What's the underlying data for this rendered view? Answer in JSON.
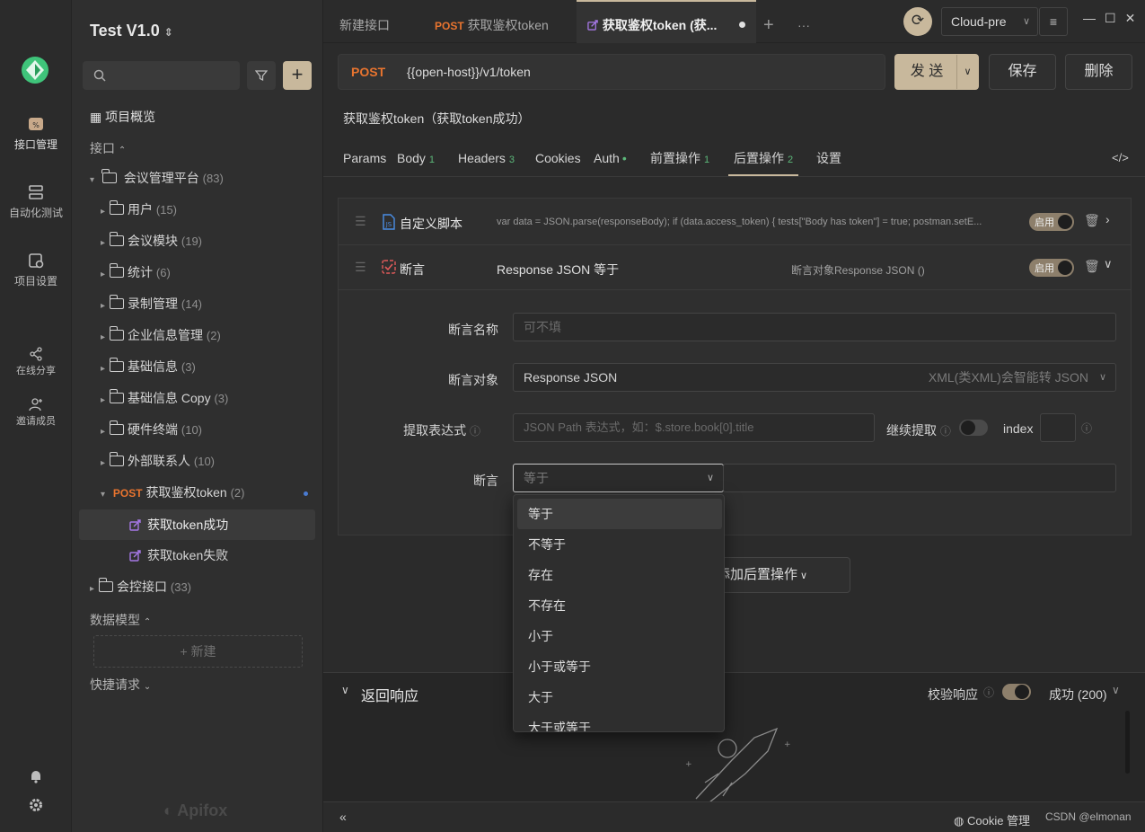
{
  "rail": {
    "items": [
      {
        "label": "接口管理",
        "icon": "api-manage-icon"
      },
      {
        "label": "自动化测试",
        "icon": "automation-icon"
      },
      {
        "label": "项目设置",
        "icon": "project-settings-icon"
      },
      {
        "label": "在线分享",
        "icon": "share-icon"
      },
      {
        "label": "邀请成员",
        "icon": "invite-member-icon"
      }
    ]
  },
  "sidebar": {
    "project_title": "Test V1.0",
    "overview": "项目概览",
    "section_api": "接口",
    "root_folder": {
      "name": "会议管理平台",
      "count": "(83)"
    },
    "folders": [
      {
        "name": "用户",
        "count": "(15)"
      },
      {
        "name": "会议模块",
        "count": "(19)"
      },
      {
        "name": "统计",
        "count": "(6)"
      },
      {
        "name": "录制管理",
        "count": "(14)"
      },
      {
        "name": "企业信息管理",
        "count": "(2)"
      },
      {
        "name": "基础信息",
        "count": "(3)"
      },
      {
        "name": "基础信息 Copy",
        "count": "(3)"
      },
      {
        "name": "硬件终端",
        "count": "(10)"
      },
      {
        "name": "外部联系人",
        "count": "(10)"
      }
    ],
    "endpoint": {
      "method": "POST",
      "name": "获取鉴权token",
      "count": "(2)"
    },
    "cases": [
      "获取token成功",
      "获取token失败"
    ],
    "other_folder": {
      "name": "会控接口",
      "count": "(33)"
    },
    "section_models": "数据模型",
    "new_button": "+ 新建",
    "section_quick": "快捷请求",
    "watermark": "Apifox"
  },
  "tabs": [
    {
      "label": "新建接口"
    },
    {
      "method": "POST",
      "label": "获取鉴权token"
    },
    {
      "label": "获取鉴权token (获..."
    }
  ],
  "env": {
    "name": "Cloud-pre"
  },
  "request": {
    "method": "POST",
    "url": "{{open-host}}/v1/token",
    "send": "发 送",
    "save": "保存",
    "delete": "删除",
    "case_title": "获取鉴权token（获取token成功）"
  },
  "subtabs": [
    {
      "label": "Params"
    },
    {
      "label": "Body",
      "badge": "1"
    },
    {
      "label": "Headers",
      "badge": "3"
    },
    {
      "label": "Cookies"
    },
    {
      "label": "Auth",
      "dot": "•"
    },
    {
      "label": "前置操作",
      "badge": "1"
    },
    {
      "label": "后置操作",
      "badge": "2"
    },
    {
      "label": "设置"
    }
  ],
  "post_ops": {
    "script": {
      "title": "自定义脚本",
      "code": "var data = JSON.parse(responseBody); if (data.access_token) { tests[\"Body has token\"] = true; postman.setE...",
      "toggle": "启用"
    },
    "assert": {
      "title": "断言",
      "summary": "Response JSON 等于",
      "target_hint": "断言对象Response JSON ()",
      "toggle": "启用"
    },
    "form": {
      "name_label": "断言名称",
      "name_placeholder": "可不填",
      "target_label": "断言对象",
      "target_value": "Response JSON",
      "target_hint": "XML(类XML)会智能转 JSON",
      "expr_label": "提取表达式",
      "expr_placeholder": "JSON Path 表达式，如：$.store.book[0].title",
      "continue_label": "继续提取",
      "index_label": "index",
      "assert_label": "断言",
      "assert_value": "等于"
    },
    "add_button": "添加后置操作"
  },
  "dropdown_options": [
    "等于",
    "不等于",
    "存在",
    "不存在",
    "小于",
    "小于或等于",
    "大于",
    "大于或等于"
  ],
  "response": {
    "title": "返回响应",
    "validate_label": "校验响应",
    "status": "成功 (200)"
  },
  "statusbar": {
    "cookie": "Cookie 管理",
    "watermark": "CSDN @elmonan"
  },
  "colors": {
    "accent": "#c8b89c",
    "method_post": "#e8742f",
    "badge": "#5cb87a",
    "logo": "#3fc47a"
  }
}
